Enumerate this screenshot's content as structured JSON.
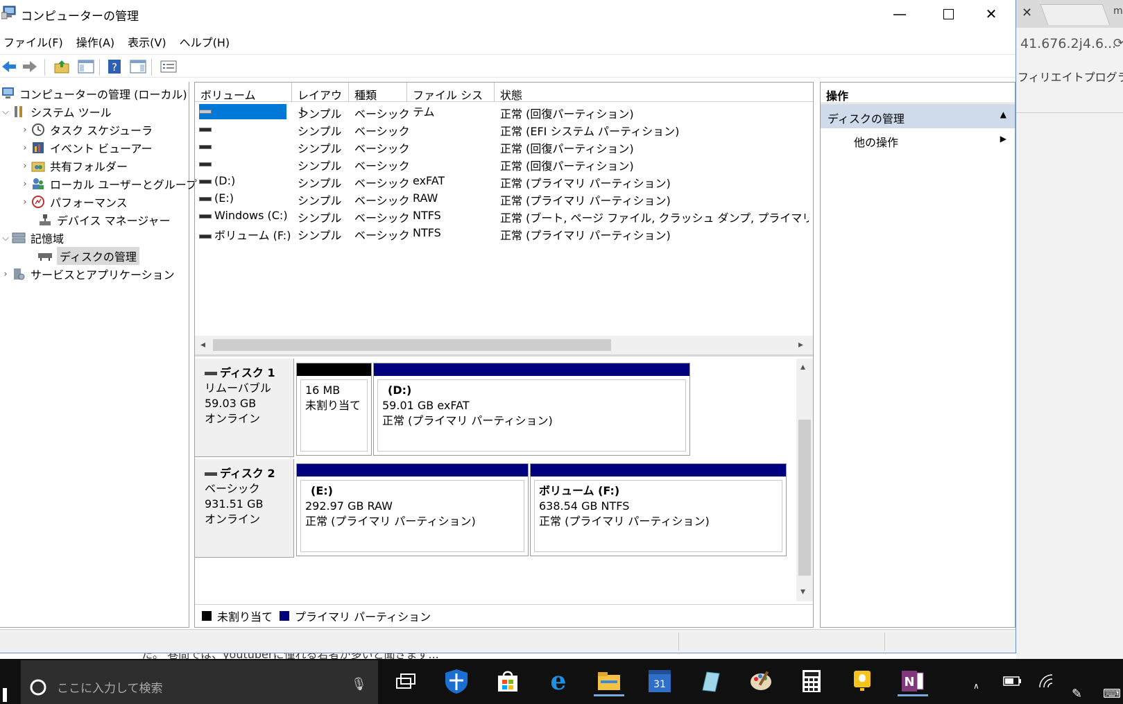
{
  "window": {
    "title": "コンピューターの管理"
  },
  "background": {
    "url_text": "41.676.2j4.6...",
    "link_text": "フィリエイトプログラムの",
    "page_text": "た。 巷間では、youtuberに憧れる若者が多いと聞きます..."
  },
  "menu": [
    "ファイル(F)",
    "操作(A)",
    "表示(V)",
    "ヘルプ(H)"
  ],
  "tree": {
    "root": "コンピューターの管理 (ローカル)",
    "system_tools": "システム ツール",
    "task_scheduler": "タスク スケジューラ",
    "event_viewer": "イベント ビューアー",
    "shared_folders": "共有フォルダー",
    "local_users": "ローカル ユーザーとグループ",
    "performance": "パフォーマンス",
    "device_manager": "デバイス マネージャー",
    "storage": "記憶域",
    "disk_management": "ディスクの管理",
    "services_apps": "サービスとアプリケーション"
  },
  "volume_list": {
    "columns": [
      "ボリューム",
      "レイアウト",
      "種類",
      "ファイル システム",
      "状態"
    ],
    "rows": [
      {
        "volume": "",
        "layout": "シンプル",
        "type": "ベーシック",
        "fs": "",
        "status": "正常 (回復パーティション)"
      },
      {
        "volume": "",
        "layout": "シンプル",
        "type": "ベーシック",
        "fs": "",
        "status": "正常 (EFI システム パーティション)"
      },
      {
        "volume": "",
        "layout": "シンプル",
        "type": "ベーシック",
        "fs": "",
        "status": "正常 (回復パーティション)"
      },
      {
        "volume": "",
        "layout": "シンプル",
        "type": "ベーシック",
        "fs": "",
        "status": "正常 (回復パーティション)"
      },
      {
        "volume": "(D:)",
        "layout": "シンプル",
        "type": "ベーシック",
        "fs": "exFAT",
        "status": "正常 (プライマリ パーティション)"
      },
      {
        "volume": "(E:)",
        "layout": "シンプル",
        "type": "ベーシック",
        "fs": "RAW",
        "status": "正常 (プライマリ パーティション)"
      },
      {
        "volume": "Windows (C:)",
        "layout": "シンプル",
        "type": "ベーシック",
        "fs": "NTFS",
        "status": "正常 (ブート, ページ ファイル, クラッシュ ダンプ, プライマリ パーティシ"
      },
      {
        "volume": "ボリューム (F:)",
        "layout": "シンプル",
        "type": "ベーシック",
        "fs": "NTFS",
        "status": "正常 (プライマリ パーティション)"
      }
    ]
  },
  "disks": [
    {
      "name": "ディスク 1",
      "kind": "リムーバブル",
      "size": "59.03 GB",
      "state": "オンライン",
      "partitions": [
        {
          "title": "",
          "line1": "16 MB",
          "line2": "未割り当て",
          "bar": "#000000"
        },
        {
          "title": "(D:)",
          "line1": "59.01 GB exFAT",
          "line2": "正常 (プライマリ パーティション)",
          "bar": "#00007f"
        }
      ]
    },
    {
      "name": "ディスク 2",
      "kind": "ベーシック",
      "size": "931.51 GB",
      "state": "オンライン",
      "partitions": [
        {
          "title": "(E:)",
          "line1": "292.97 GB RAW",
          "line2": "正常 (プライマリ パーティション)",
          "bar": "#00007f"
        },
        {
          "title": "ボリューム (F:)",
          "line1": "638.54 GB NTFS",
          "line2": "正常 (プライマリ パーティション)",
          "bar": "#00007f"
        }
      ]
    }
  ],
  "legend": [
    {
      "label": "未割り当て",
      "color": "#000000"
    },
    {
      "label": "プライマリ パーティション",
      "color": "#00007f"
    }
  ],
  "actions": {
    "header": "操作",
    "section": "ディスクの管理",
    "item": "他の操作"
  },
  "taskbar": {
    "search_placeholder": "ここに入力して検索",
    "calendar_day": "31"
  },
  "colors": {
    "accent": "#cfdbea",
    "primary_partition": "#00007f",
    "unallocated": "#000000"
  }
}
